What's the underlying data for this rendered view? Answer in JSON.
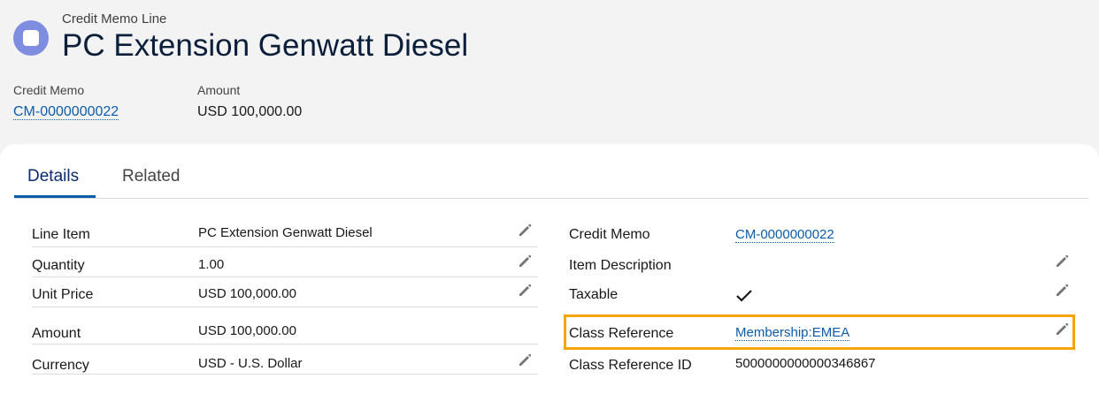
{
  "header": {
    "object_type": "Credit Memo Line",
    "title": "PC Extension Genwatt Diesel",
    "highlights": [
      {
        "label": "Credit Memo",
        "value": "CM-0000000022",
        "is_link": true
      },
      {
        "label": "Amount",
        "value": "USD 100,000.00",
        "is_link": false
      }
    ]
  },
  "tabs": [
    {
      "label": "Details",
      "active": true
    },
    {
      "label": "Related",
      "active": false
    }
  ],
  "left_fields": [
    {
      "label": "Line Item",
      "value": "PC Extension Genwatt Diesel",
      "editable": true
    },
    {
      "label": "Quantity",
      "value": "1.00",
      "editable": true
    },
    {
      "label": "Unit Price",
      "value": "USD 100,000.00",
      "editable": true
    },
    {
      "label": "Amount",
      "value": "USD 100,000.00",
      "editable": false
    },
    {
      "label": "Currency",
      "value": "USD - U.S. Dollar",
      "editable": true
    }
  ],
  "right_fields": [
    {
      "label": "Credit Memo",
      "value": "CM-0000000022",
      "is_link": true,
      "editable": false
    },
    {
      "label": "Item Description",
      "value": "",
      "editable": true
    },
    {
      "label": "Taxable",
      "value": "",
      "checked": true,
      "editable": true
    },
    {
      "label": "Class Reference",
      "value": "Membership:EMEA",
      "is_link": true,
      "editable": true,
      "highlighted": true
    },
    {
      "label": "Class Reference ID",
      "value": "5000000000000346867",
      "editable": false
    }
  ],
  "colors": {
    "accent": "#0b5cab",
    "icon_bg": "#7f8de1",
    "highlight": "#f5a50a"
  },
  "icons": {
    "record": "credit-memo-line-icon",
    "edit": "pencil-icon",
    "check": "checkmark-icon"
  }
}
